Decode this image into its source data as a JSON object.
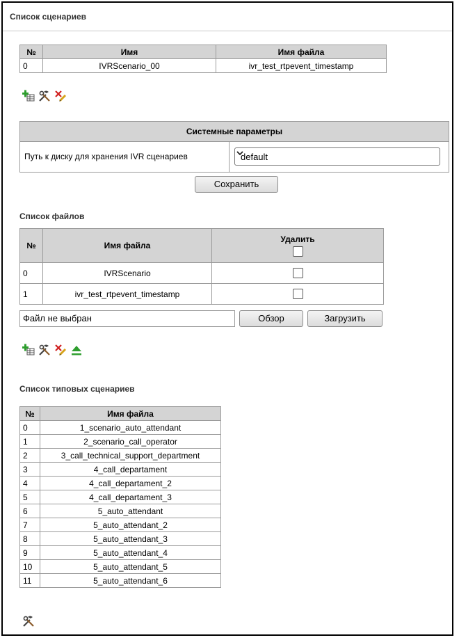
{
  "scenarios": {
    "title": "Список сценариев",
    "headers": [
      "№",
      "Имя",
      "Имя файла"
    ],
    "rows": [
      {
        "num": "0",
        "name": "IVRScenario_00",
        "file": "ivr_test_rtpevent_timestamp"
      }
    ]
  },
  "system": {
    "title": "Системные параметры",
    "disk_label": "Путь к диску для хранения IVR сценариев",
    "disk_value": "default",
    "save_label": "Сохранить"
  },
  "files": {
    "title": "Список файлов",
    "headers": [
      "№",
      "Имя файла",
      "Удалить"
    ],
    "rows": [
      {
        "num": "0",
        "file": "IVRScenario"
      },
      {
        "num": "1",
        "file": "ivr_test_rtpevent_timestamp"
      }
    ],
    "file_input_text": "Файл не выбран",
    "browse_label": "Обзор",
    "upload_label": "Загрузить"
  },
  "templates": {
    "title": "Список типовых сценариев",
    "headers": [
      "№",
      "Имя файла"
    ],
    "rows": [
      {
        "num": "0",
        "file": "1_scenario_auto_attendant"
      },
      {
        "num": "1",
        "file": "2_scenario_call_operator"
      },
      {
        "num": "2",
        "file": "3_call_technical_support_department"
      },
      {
        "num": "3",
        "file": "4_call_departament"
      },
      {
        "num": "4",
        "file": "4_call_departament_2"
      },
      {
        "num": "5",
        "file": "4_call_departament_3"
      },
      {
        "num": "6",
        "file": "5_auto_attendant"
      },
      {
        "num": "7",
        "file": "5_auto_attendant_2"
      },
      {
        "num": "8",
        "file": "5_auto_attendant_3"
      },
      {
        "num": "9",
        "file": "5_auto_attendant_4"
      },
      {
        "num": "10",
        "file": "5_auto_attendant_5"
      },
      {
        "num": "11",
        "file": "5_auto_attendant_6"
      }
    ]
  },
  "icons": {
    "add": "add-table-icon",
    "edit": "tools-icon",
    "delete": "delete-icon",
    "upload": "upload-arrow-icon"
  },
  "colors": {
    "header_bg": "#d4d4d4",
    "border": "#9a9a9a",
    "upload_green": "#2e9e2e"
  }
}
